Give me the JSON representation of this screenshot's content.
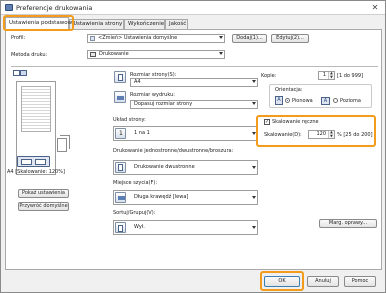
{
  "window": {
    "title": "Preferencje drukowania",
    "close_glyph": "✕"
  },
  "tabs": [
    {
      "label": "Ustawienia podstawowe"
    },
    {
      "label": "Ustawienia strony"
    },
    {
      "label": "Wykończenie"
    },
    {
      "label": "Jakość"
    }
  ],
  "profile": {
    "label": "Profil:",
    "value": "<Zmień> Ustawienia domyślne",
    "add_button": "Dodaj(1)...",
    "edit_button": "Edytuj(2)..."
  },
  "output_method": {
    "label": "Metoda druku:",
    "value": "Drukowanie"
  },
  "preview": {
    "caption": "A4 [Skalowanie: 120%]",
    "show_settings_button": "Pokaż ustawienia",
    "restore_defaults_button": "Przywróć domyślne"
  },
  "page_size": {
    "label": "Rozmiar strony(S):",
    "value": "A4"
  },
  "output_size": {
    "label": "Rozmiar wydruku:",
    "value": "Dopasuj rozmiar strony"
  },
  "copies": {
    "label": "Kopie:",
    "value": "1",
    "range": "[1 do 999]"
  },
  "orientation": {
    "label": "Orientacja:",
    "portrait": "Pionowa",
    "landscape": "Pozioma",
    "selected": "portrait"
  },
  "manual_scaling": {
    "label": "Skalowanie ręczne",
    "checked": true,
    "scale_label": "Skalowanie(D):",
    "value": "120",
    "range": "% [25 do 200]"
  },
  "page_layout": {
    "label": "Układ strony:",
    "value": "1 na 1"
  },
  "duplex": {
    "label": "Drukowanie jednostronne/dwustronne/broszura:",
    "value": "Drukowanie dwustronne"
  },
  "binding": {
    "label": "Miejsce szycia(F):",
    "value": "Długa krawędź [lewa]"
  },
  "collate": {
    "label": "Sortuj/Grupuj(V):",
    "value": "Wył."
  },
  "margin_button": "Marg. oprawy...",
  "footer": {
    "ok": "OK",
    "cancel": "Anuluj",
    "help": "Pomoc"
  },
  "colors": {
    "highlight": "#f39b1b",
    "accent": "#1e5ec8"
  }
}
